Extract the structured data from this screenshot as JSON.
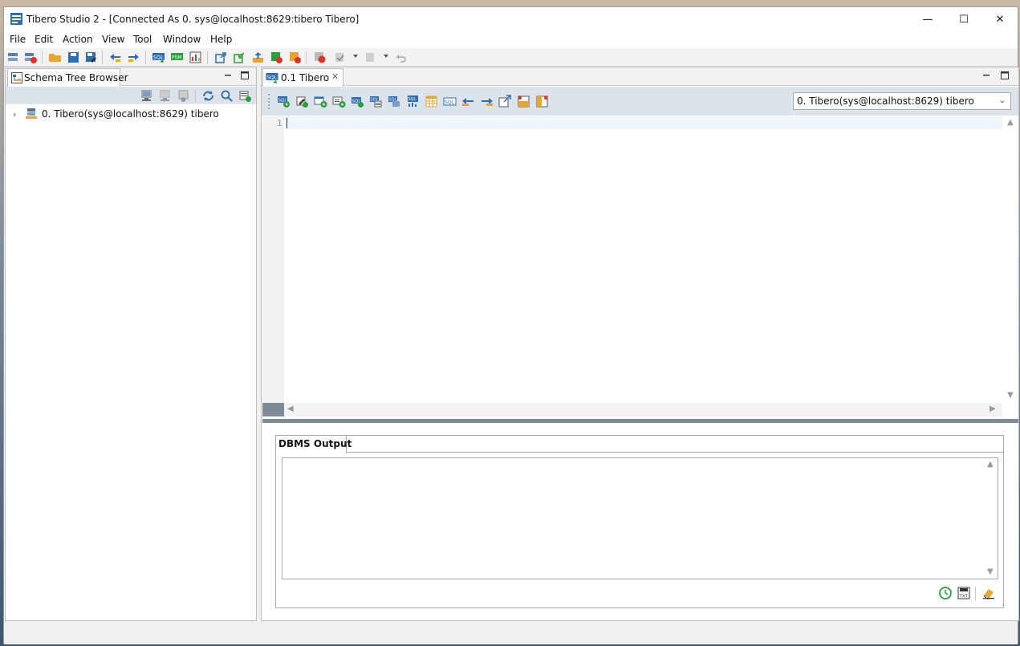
{
  "window": {
    "title": "Tibero Studio 2 - [Connected As 0. sys@localhost:8629:tibero Tibero]",
    "controls": {
      "minimize": "—",
      "maximize": "☐",
      "close": "✕"
    }
  },
  "menu": [
    "File",
    "Edit",
    "Action",
    "View",
    "Tool",
    "Window",
    "Help"
  ],
  "left_panel": {
    "tab_label": "Schema Tree Browser",
    "tree": [
      {
        "label": "0. Tibero(sys@localhost:8629) tibero",
        "expander": "›"
      }
    ]
  },
  "editor": {
    "tab_label": "0.1 Tibero",
    "tab_close": "✕",
    "connection": "0. Tibero(sys@localhost:8629) tibero",
    "select_arrow": "⌄",
    "line_numbers": [
      "1"
    ]
  },
  "dbms_output": {
    "tab_label": "DBMS Output"
  },
  "scroll": {
    "up": "▲",
    "down": "▼",
    "left": "◀",
    "right": "▶"
  },
  "colors": {
    "accent": "#2f6db3",
    "toolbar_band": "#dde3ea",
    "splitter": "#7f8a99"
  }
}
